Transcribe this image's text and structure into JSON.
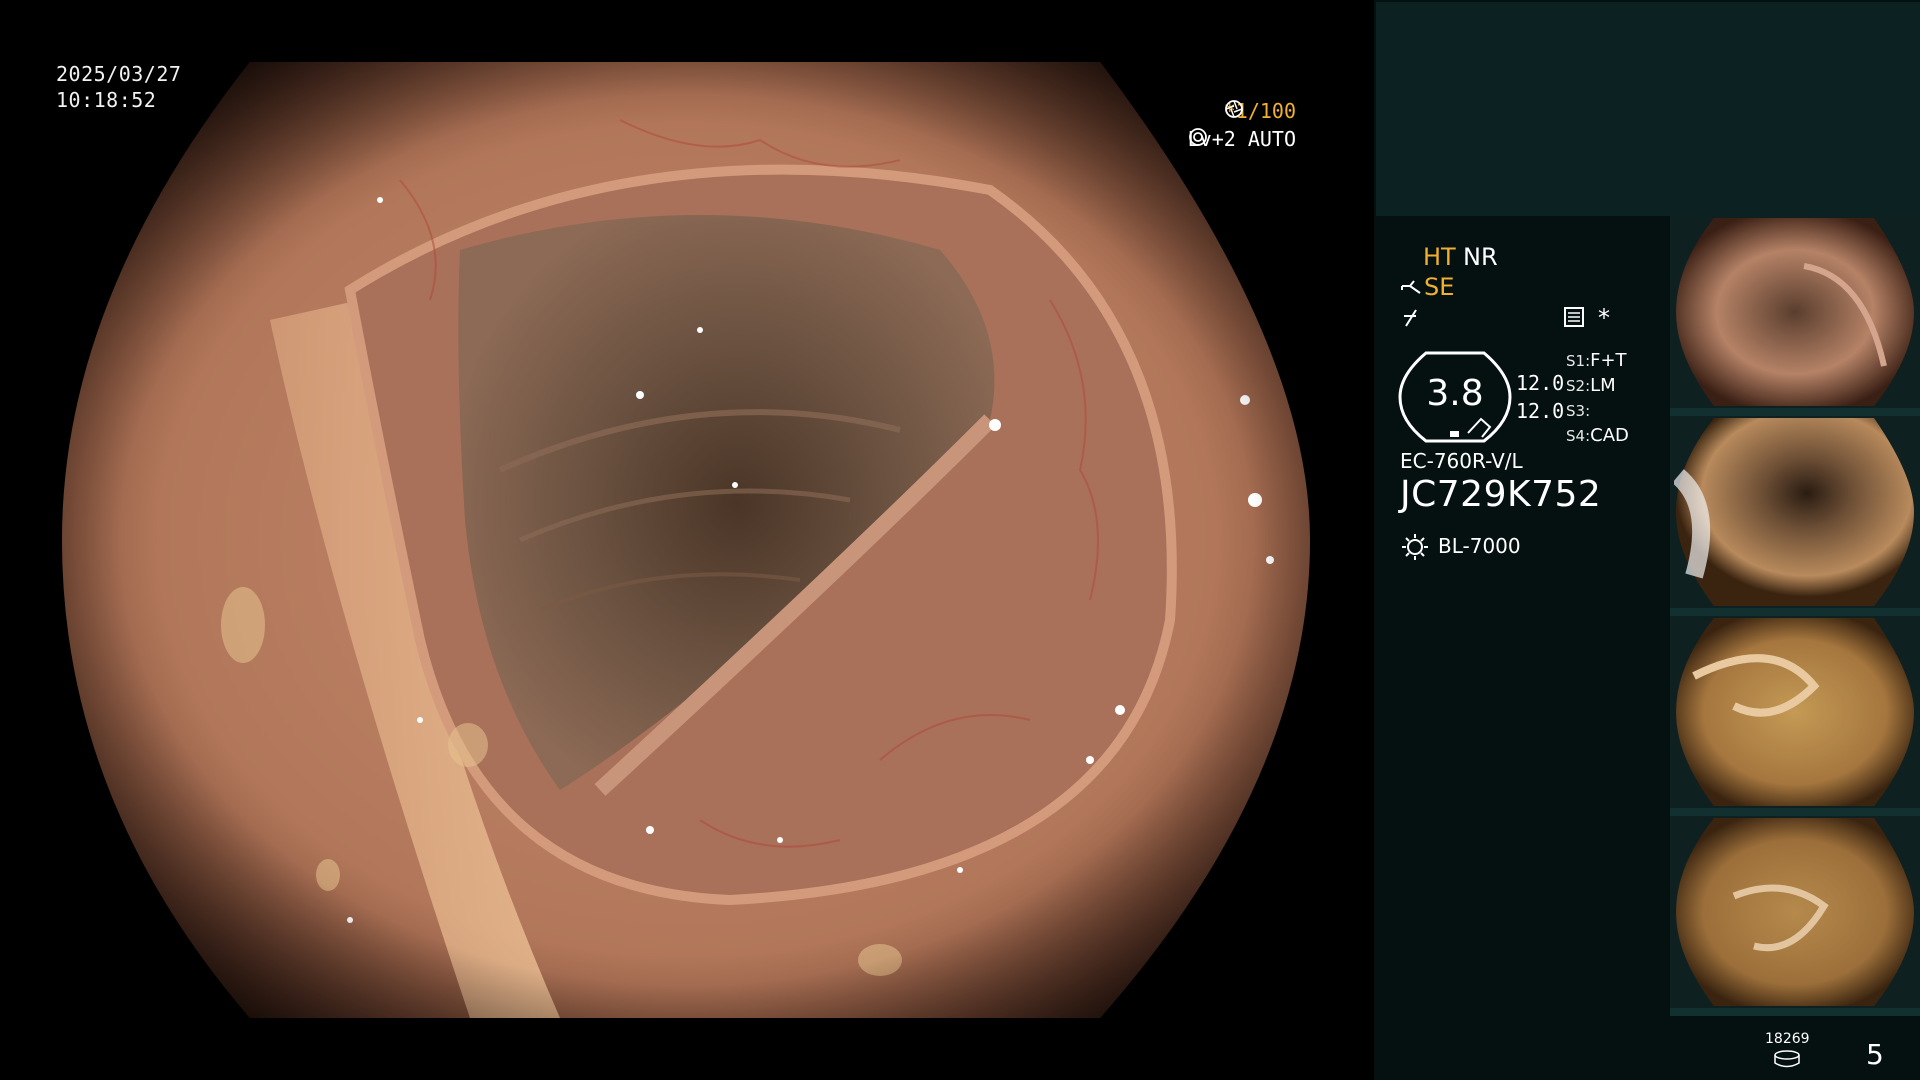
{
  "overlay": {
    "date": "2025/03/27",
    "time": "10:18:52",
    "shutter": "*1/100",
    "shutter_icon": "aperture-icon",
    "level": "Lv+2 AUTO",
    "level_icon": "auto-iris-icon"
  },
  "modes": {
    "ht": "HT",
    "nr": "NR",
    "se": "SE",
    "se_icon": "scope-icon",
    "freeze_icon": "freeze-icon",
    "settings_icon": "image-settings-icon",
    "asterisk": "*"
  },
  "scope_info": {
    "diameter": "3.8",
    "value_1": "12.0",
    "value_2": "12.0",
    "model": "EC-760R-V/L",
    "serial": "JC729K752",
    "light_source": "BL-7000",
    "light_icon": "light-source-icon"
  },
  "switches": [
    {
      "key": "S1:",
      "value": "F+T"
    },
    {
      "key": "S2:",
      "value": "LM"
    },
    {
      "key": "S3:",
      "value": ""
    },
    {
      "key": "S4:",
      "value": "CAD"
    }
  ],
  "storage": {
    "count": "18269",
    "icon": "disk-icon",
    "page": "5"
  },
  "colors": {
    "panel_bg": "#051010",
    "panel_top_bg": "#0c2222",
    "accent_orange": "#f0b030",
    "tissue": "#b77a5e"
  },
  "thumbnails": [
    {
      "name": "thumbnail-1"
    },
    {
      "name": "thumbnail-2"
    },
    {
      "name": "thumbnail-3"
    },
    {
      "name": "thumbnail-4"
    }
  ]
}
